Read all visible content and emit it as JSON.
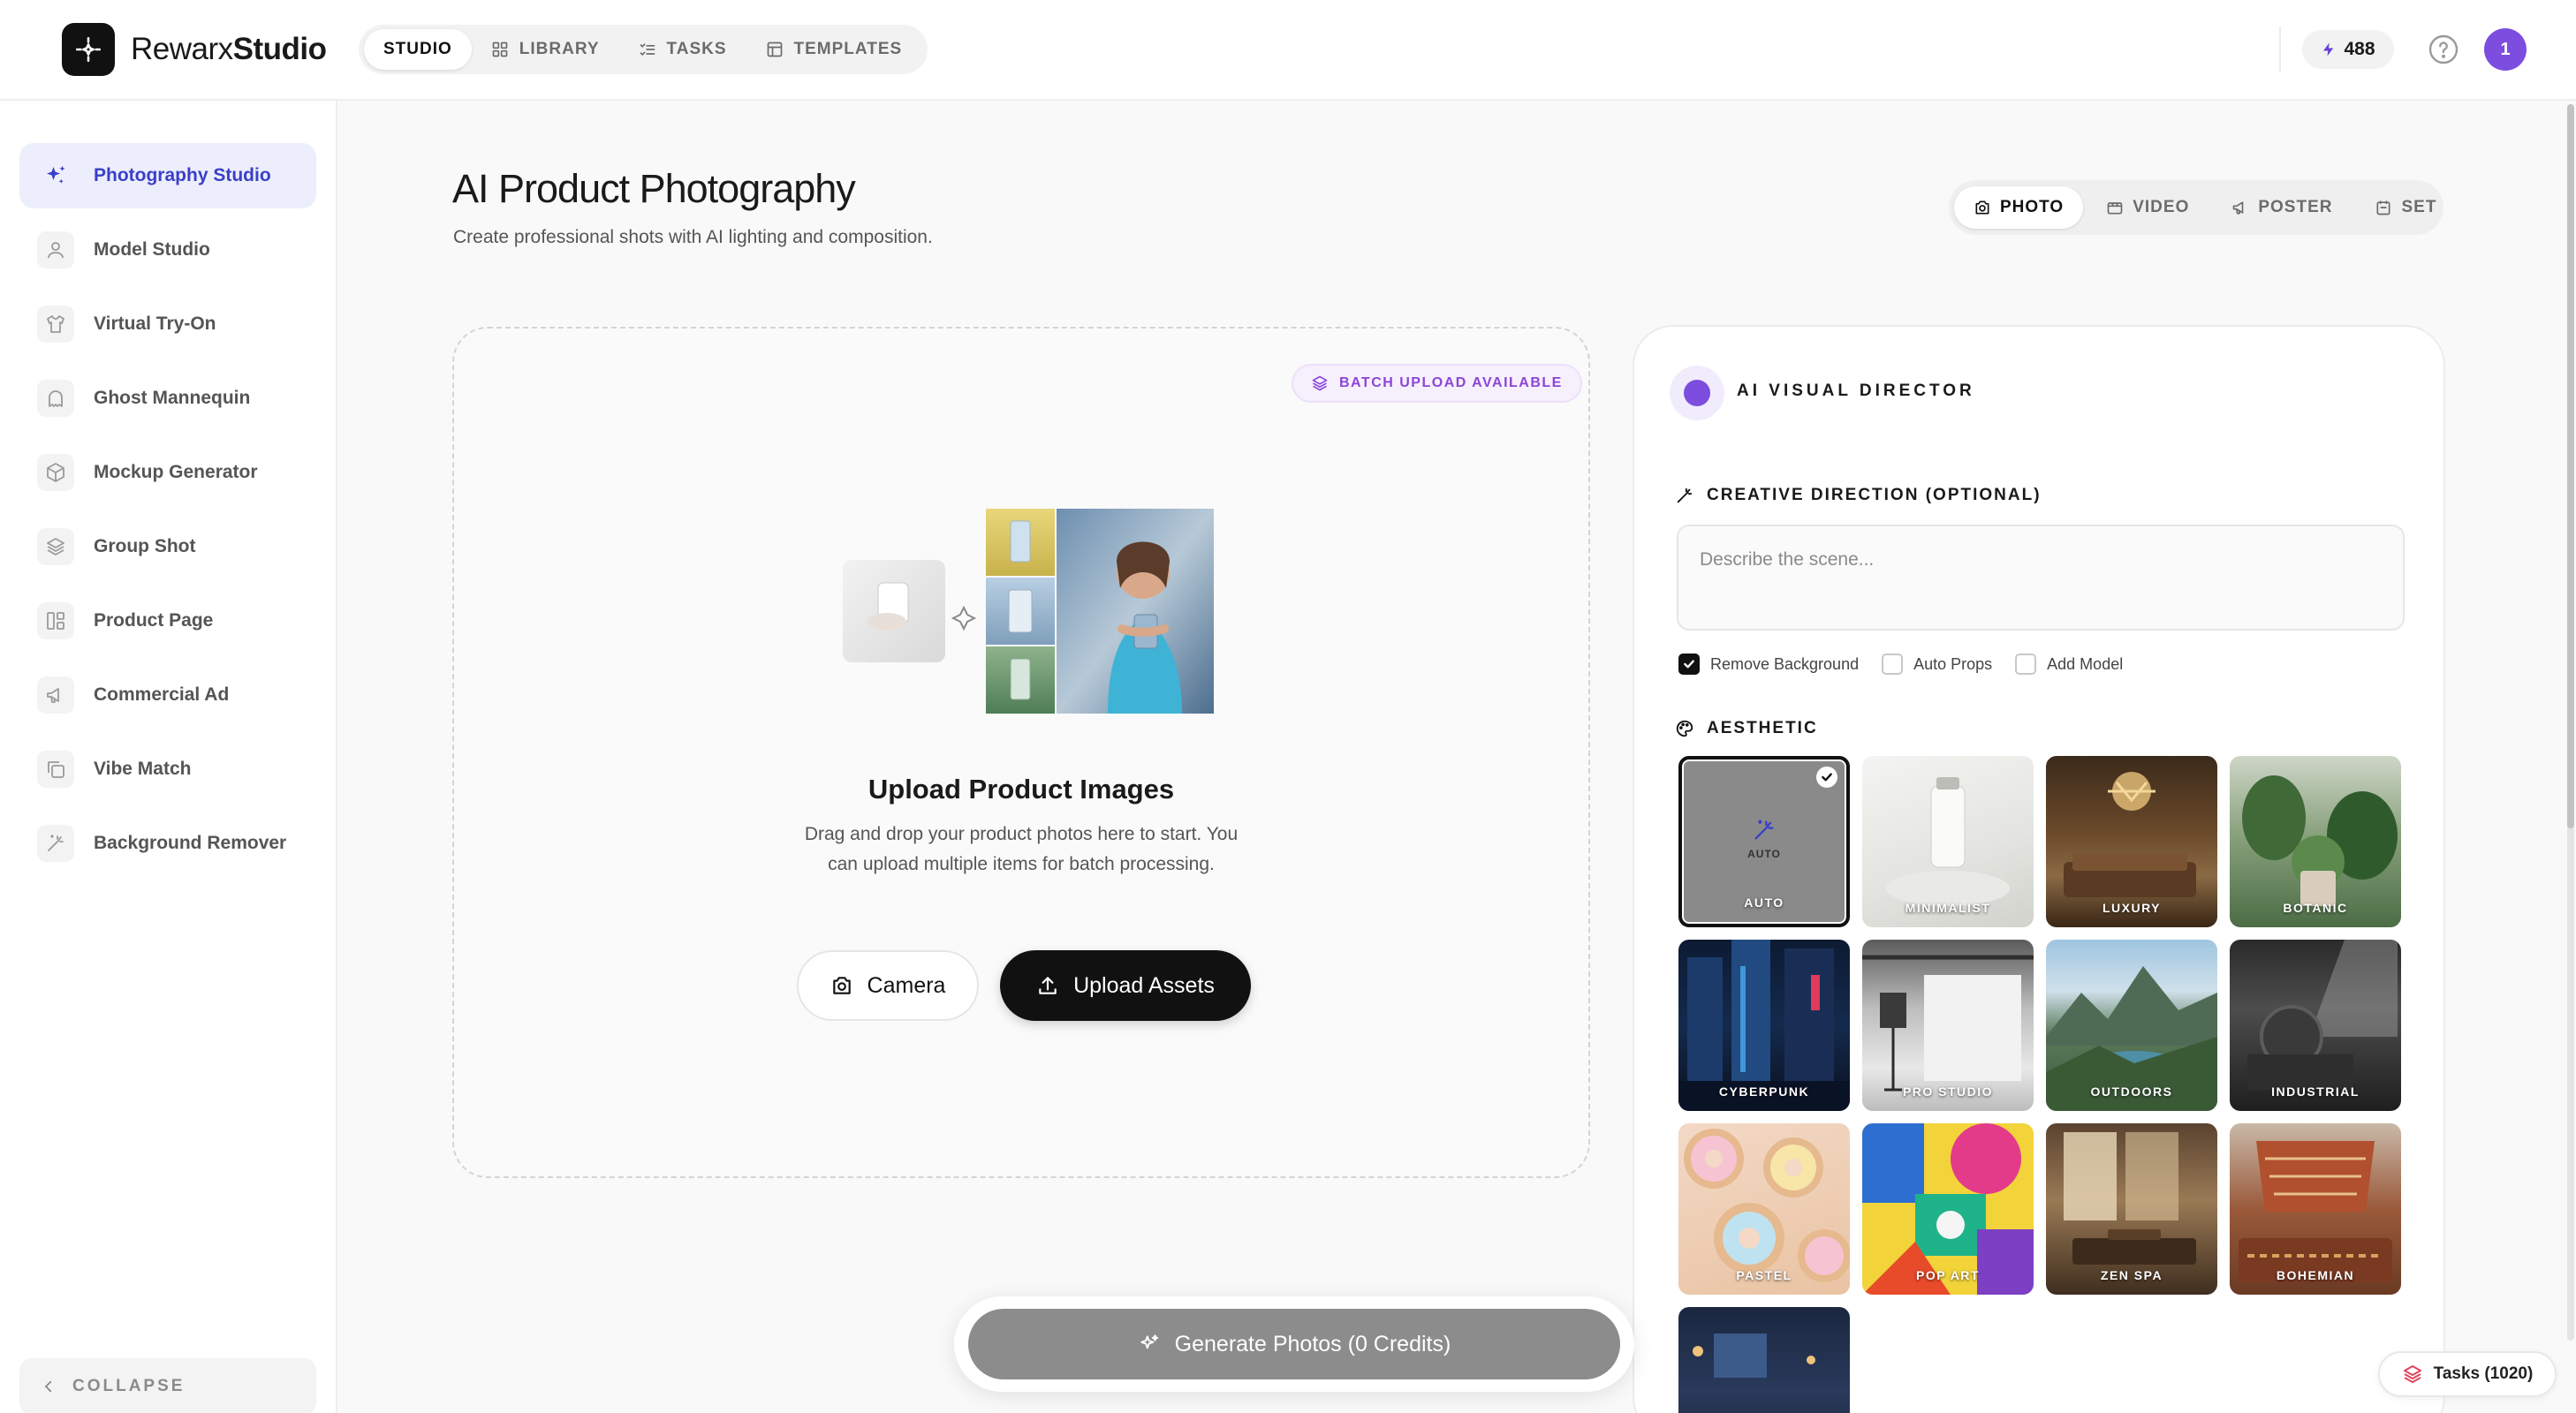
{
  "brand": {
    "name_regular": "Rewarx",
    "name_bold": "Studio"
  },
  "nav": {
    "tabs": [
      {
        "label": "STUDIO",
        "icon": "none"
      },
      {
        "label": "LIBRARY",
        "icon": "grid-icon"
      },
      {
        "label": "TASKS",
        "icon": "checklist-icon"
      },
      {
        "label": "TEMPLATES",
        "icon": "template-icon"
      }
    ]
  },
  "header": {
    "credits": "488",
    "avatar_initial": "1"
  },
  "sidebar": {
    "items": [
      {
        "label": "Photography Studio",
        "icon": "sparkle-icon",
        "active": true
      },
      {
        "label": "Model Studio",
        "icon": "user-icon"
      },
      {
        "label": "Virtual Try-On",
        "icon": "shirt-icon"
      },
      {
        "label": "Ghost Mannequin",
        "icon": "ghost-icon"
      },
      {
        "label": "Mockup Generator",
        "icon": "box-icon"
      },
      {
        "label": "Group Shot",
        "icon": "layers-icon"
      },
      {
        "label": "Product Page",
        "icon": "layout-icon"
      },
      {
        "label": "Commercial Ad",
        "icon": "megaphone-icon"
      },
      {
        "label": "Vibe Match",
        "icon": "copy-icon"
      },
      {
        "label": "Background Remover",
        "icon": "wand-icon"
      }
    ],
    "collapse_label": "COLLAPSE"
  },
  "main": {
    "title": "AI Product Photography",
    "subtitle": "Create professional shots with AI lighting and composition.",
    "mode_tabs": [
      {
        "label": "PHOTO",
        "icon": "camera-icon",
        "active": true
      },
      {
        "label": "VIDEO",
        "icon": "video-icon"
      },
      {
        "label": "POSTER",
        "icon": "megaphone-icon"
      },
      {
        "label": "SET",
        "icon": "set-icon"
      }
    ]
  },
  "upload": {
    "badge": "BATCH UPLOAD AVAILABLE",
    "title": "Upload Product Images",
    "description": "Drag and drop your product photos here to start. You can upload multiple items for batch processing.",
    "camera_label": "Camera",
    "upload_label": "Upload Assets"
  },
  "director": {
    "title": "AI VISUAL DIRECTOR",
    "creative_label": "CREATIVE DIRECTION (OPTIONAL)",
    "scene_placeholder": "Describe the scene...",
    "options": [
      {
        "label": "Remove Background",
        "checked": true
      },
      {
        "label": "Auto Props",
        "checked": false
      },
      {
        "label": "Add Model",
        "checked": false
      }
    ],
    "aesthetic_label": "AESTHETIC",
    "auto_inner_label": "AUTO",
    "aesthetics": [
      "AUTO",
      "MINIMALIST",
      "LUXURY",
      "BOTANIC",
      "CYBERPUNK",
      "PRO STUDIO",
      "OUTDOORS",
      "INDUSTRIAL",
      "PASTEL",
      "POP ART",
      "ZEN SPA",
      "BOHEMIAN",
      ""
    ]
  },
  "generate": {
    "label": "Generate Photos (0 Credits)"
  },
  "tasks_pill": {
    "label": "Tasks (1020)"
  },
  "colors": {
    "accent": "#7c4ddf",
    "active_nav": "#3a3fc8",
    "active_nav_bg": "#edeefb",
    "dark": "#111111"
  }
}
